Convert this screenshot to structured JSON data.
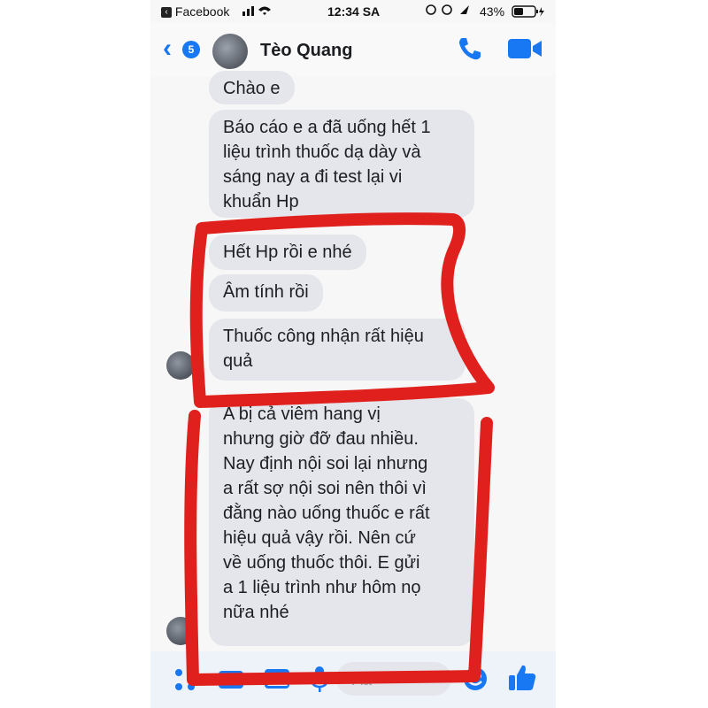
{
  "status_bar": {
    "back_app": "Facebook",
    "time": "12:34 SA",
    "battery": "43%"
  },
  "header": {
    "back_count": "5",
    "contact_name": "Tèo Quang"
  },
  "messages": [
    {
      "lines": [
        "Chào e"
      ]
    },
    {
      "lines": [
        "Báo cáo e a đã uống hết 1",
        "liệu trình thuốc dạ dày và",
        "sáng nay a đi test lại vi",
        "khuẩn Hp"
      ]
    },
    {
      "lines": [
        "Hết Hp rồi e nhé"
      ]
    },
    {
      "lines": [
        "Âm tính rồi"
      ]
    },
    {
      "lines": [
        "Thuốc công nhận rất hiệu",
        "quả"
      ]
    },
    {
      "lines": [
        "A bị cả viêm hang vị",
        "nhưng giờ đỡ đau nhiều.",
        "Nay định nội soi lại nhưng",
        "a rất sợ nội soi nên thôi vì",
        "đằng nào uống thuốc e rất",
        "hiệu quả vậy rồi. Nên cứ",
        "về uống thuốc thôi. E gửi",
        "a 1 liệu trình như hôm nọ",
        "nữa nhé"
      ]
    }
  ],
  "composer": {
    "placeholder": "Aa"
  },
  "colors": {
    "accent": "#1877f2",
    "bubble": "#e4e6eb",
    "annotation": "#e0201c"
  }
}
